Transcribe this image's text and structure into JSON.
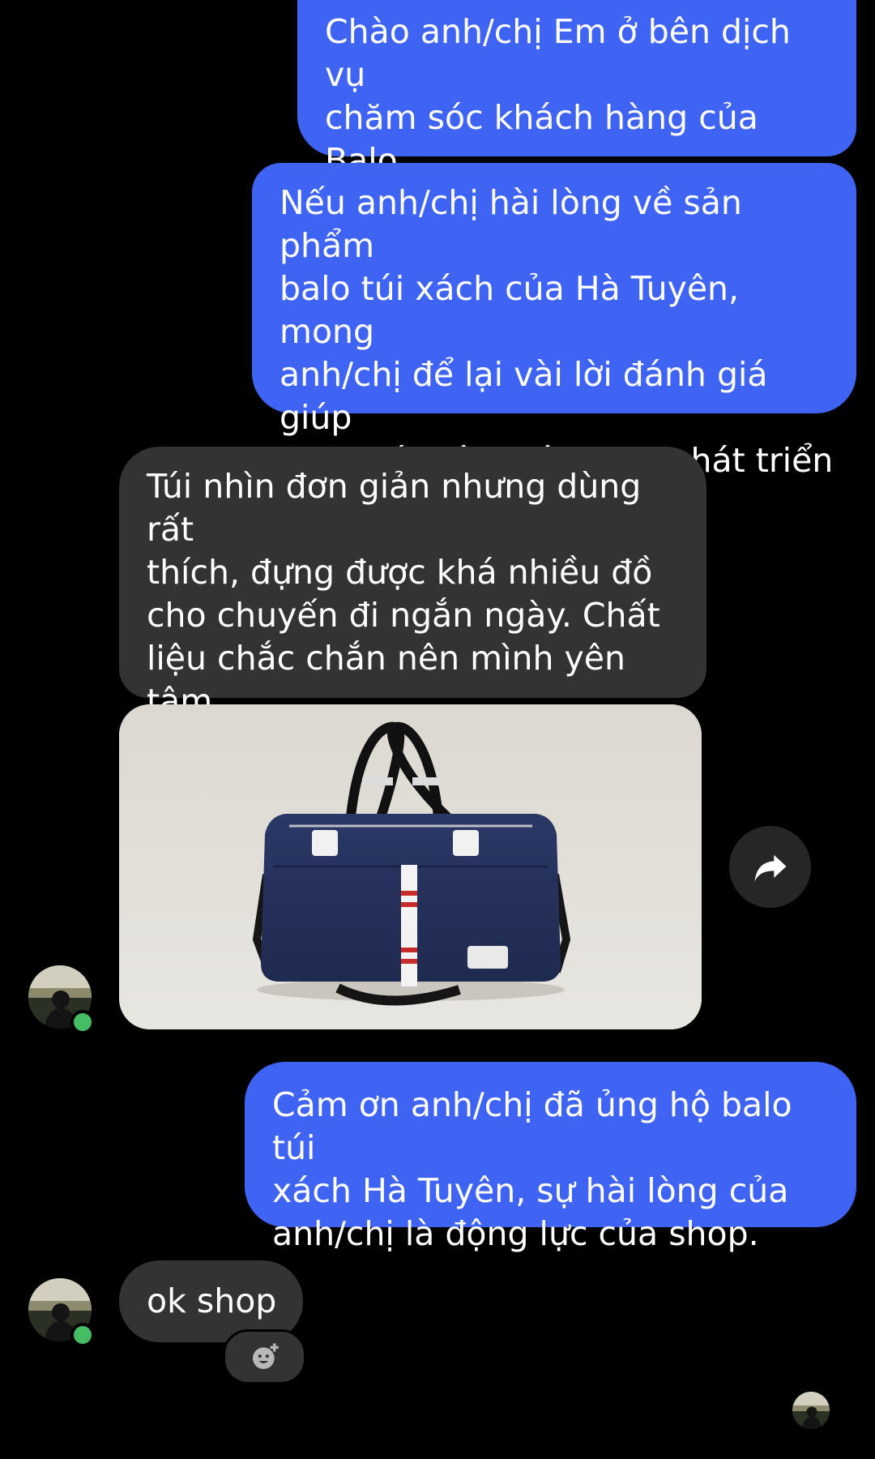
{
  "messages": [
    {
      "sender": "shop",
      "text": "Chào anh/chị Em ở bên dịch vụ\nchăm sóc khách hàng của Balo\nHà Tuyên"
    },
    {
      "sender": "shop",
      "text": "Nếu anh/chị hài lòng về sản phẩm\nbalo túi xách của Hà Tuyên, mong\nanh/chị để lại vài lời đánh giá giúp\nshop có thêm động lực phát triển\nạ."
    },
    {
      "sender": "customer",
      "text": "Túi nhìn đơn giản nhưng dùng rất\nthích, đựng được khá nhiều đồ\ncho chuyến đi ngắn ngày. Chất\nliệu chắc chắn nên mình yên tâm\nkhi mang theo."
    },
    {
      "sender": "customer",
      "type": "image",
      "image_subject": "navy blue duffel bag with white handle patches and red-white striped strap"
    },
    {
      "sender": "shop",
      "text": "Cảm ơn anh/chị đã ủng hộ balo túi\nxách Hà Tuyên, sự hài lòng của\nanh/chị là động lực của shop."
    },
    {
      "sender": "customer",
      "text": "ok shop"
    }
  ],
  "icons": {
    "forward": "forward-share-icon",
    "reaction": "add-reaction-icon",
    "presence": "online-status-dot",
    "seen": "seen-receipt-avatar"
  },
  "colors": {
    "background": "#000000",
    "outgoing_bubble": "#3f64f4",
    "incoming_bubble": "#333333",
    "online": "#45bd62"
  }
}
